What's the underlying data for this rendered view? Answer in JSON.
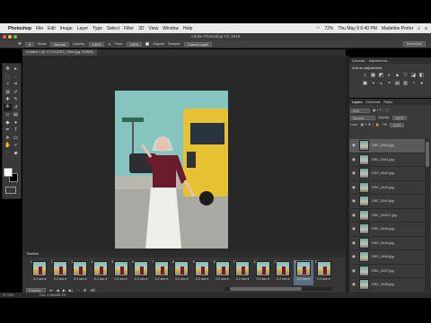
{
  "menubar": {
    "app": "Photoshop",
    "items": [
      "File",
      "Edit",
      "Image",
      "Layer",
      "Type",
      "Select",
      "Filter",
      "3D",
      "View",
      "Window",
      "Help"
    ],
    "battery": "72%",
    "clock": "Thu May 9  6:40 PM",
    "user": "Madeline Porter"
  },
  "app": {
    "title": "Adobe Photoshop CC 2018"
  },
  "options": {
    "mode_label": "Mode:",
    "mode_value": "Normal",
    "opacity_label": "Opacity:",
    "opacity_value": "100%",
    "flow_label": "Flow:",
    "flow_value": "100%",
    "aligned_label": "Aligned",
    "sample_label": "Sample:",
    "sample_value": "Current Layer",
    "workspace": "Essentials"
  },
  "document": {
    "tab": "Untitled-1 @ 17.1% (DSC_0444.jpg, RGB/8)"
  },
  "panels": {
    "adjust_tabs": [
      "Libraries",
      "Adjustments"
    ],
    "adjust_title": "Add an adjustment",
    "adjust_icons": [
      "☼",
      "▦",
      "◩",
      "◐",
      "▲",
      "▽",
      "◪",
      "◧",
      "▣",
      "◑",
      "◒",
      "◓",
      "▤",
      "▥",
      "◔",
      "◕"
    ],
    "layers_tabs": [
      "Layers",
      "Channels",
      "Paths"
    ],
    "kind": "Kind",
    "blend": "Normal",
    "opacity_label": "Opacity:",
    "opacity": "100%",
    "lock_label": "Lock:",
    "fill_label": "Fill:",
    "fill": "100%",
    "layers": [
      {
        "name": "DSC_0444.jpg",
        "selected": true
      },
      {
        "name": "DSC_0441.jpg",
        "selected": false
      },
      {
        "name": "DSC_0442.jpg",
        "selected": false
      },
      {
        "name": "DSC_0443.jpg",
        "selected": false
      },
      {
        "name": "DSC_0440.jpg",
        "selected": false
      },
      {
        "name": "DSC_0439 1.jpg",
        "selected": false
      },
      {
        "name": "DSC_0445.jpg",
        "selected": false
      },
      {
        "name": "DSC_0446.jpg",
        "selected": false
      },
      {
        "name": "DSC_0448.jpg",
        "selected": false
      },
      {
        "name": "DSC_0437.jpg",
        "selected": false
      },
      {
        "name": "DSC_0438.jpg",
        "selected": false
      }
    ]
  },
  "timeline": {
    "title": "Timeline",
    "loop": "Forever",
    "frames": [
      {
        "n": "1",
        "dur": "0.2 sec.▾"
      },
      {
        "n": "2",
        "dur": "0.2 sec.▾"
      },
      {
        "n": "3",
        "dur": "0.2 sec.▾"
      },
      {
        "n": "4",
        "dur": "0.2 sec.▾"
      },
      {
        "n": "5",
        "dur": "0.2 sec.▾"
      },
      {
        "n": "6",
        "dur": "0.2 sec.▾"
      },
      {
        "n": "7",
        "dur": "0.2 sec.▾"
      },
      {
        "n": "8",
        "dur": "0.2 sec.▾"
      },
      {
        "n": "9",
        "dur": "0.2 sec.▾"
      },
      {
        "n": "10",
        "dur": "0.2 sec.▾"
      },
      {
        "n": "11",
        "dur": "0.2 sec.▾"
      },
      {
        "n": "12",
        "dur": "0.2 sec.▾"
      },
      {
        "n": "13",
        "dur": "0.2 sec.▾"
      },
      {
        "n": "14",
        "dur": "0.2 sec.▾"
      },
      {
        "n": "15",
        "dur": "0.2 sec.▾"
      }
    ],
    "selected_frame": "14"
  },
  "status": {
    "zoom": "17.13%",
    "doc": "Doc: 4.36M/68.7M"
  }
}
